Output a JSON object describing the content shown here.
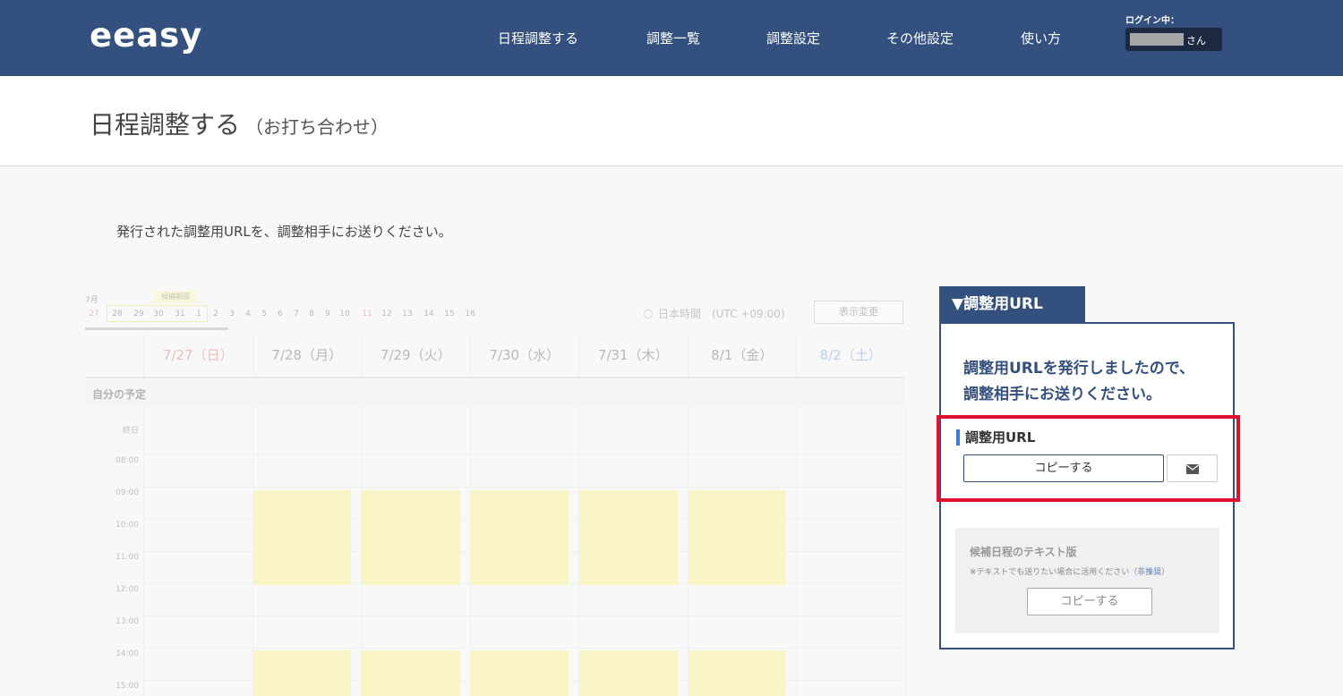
{
  "header": {
    "logo": "eeasy",
    "nav": [
      "日程調整する",
      "調整一覧",
      "調整設定",
      "その他設定",
      "使い方"
    ],
    "login_label": "ログイン中：",
    "user_suffix": "さん"
  },
  "page": {
    "title": "日程調整する",
    "subtitle": "（お打ち合わせ）",
    "instruction": "発行された調整用URLを、調整相手にお送りください。"
  },
  "calendar": {
    "month_label": "7月",
    "range_label": "候補期間",
    "days": [
      "27",
      "28",
      "29",
      "30",
      "31",
      "1",
      "2",
      "3",
      "4",
      "5",
      "6",
      "7",
      "8",
      "9",
      "10",
      "11",
      "12",
      "13",
      "14",
      "15",
      "16"
    ],
    "timezone": "日本時間　(UTC +09:00)",
    "view_button": "表示変更",
    "columns": [
      "7/27（日）",
      "7/28（月）",
      "7/29（火）",
      "7/30（水）",
      "7/31（木）",
      "8/1（金）",
      "8/2（土）"
    ],
    "column_colors": [
      "#e05050",
      "#444444",
      "#444444",
      "#444444",
      "#444444",
      "#444444",
      "#4a86d8"
    ],
    "own_schedule_label": "自分の予定",
    "all_day_label": "終日",
    "times": [
      "08:00",
      "09:00",
      "10:00",
      "11:00",
      "12:00",
      "13:00",
      "14:00",
      "15:00"
    ]
  },
  "url_panel": {
    "tab_label": "▼調整用URL",
    "message_line1": "調整用URLを発行しましたので、",
    "message_line2": "調整相手にお送りください。",
    "url_label": "調整用URL",
    "copy_button": "コピーする",
    "mail_icon": "envelope-icon",
    "text_version_title": "候補日程のテキスト版",
    "text_version_note": "※テキストでも送りたい場合に活用ください（",
    "text_version_note_link": "非推奨",
    "text_version_note_end": "）",
    "text_version_copy_button": "コピーする"
  },
  "colors": {
    "brand": "#34507e",
    "highlight": "#e0102f",
    "slot": "#fff06a"
  }
}
